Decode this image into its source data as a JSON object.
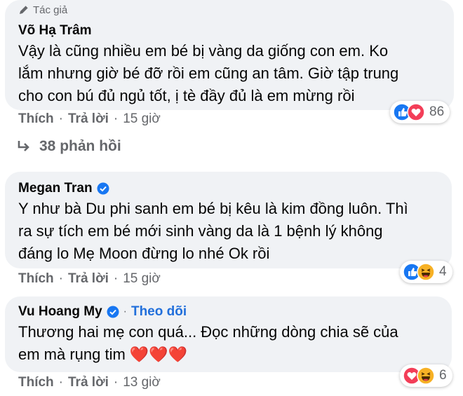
{
  "comments": [
    {
      "badge": "Tác giả",
      "author": "Võ Hạ Trâm",
      "lines": [
        "Vậy là cũng nhiều em bé bị vàng da giống con em. Ko",
        "lắm nhưng giờ bé đỡ rồi em cũng an tâm. Giờ tập trung",
        "cho con bú đủ ngủ tốt, ị tè đầy đủ là em mừng rồi"
      ],
      "like": "Thích",
      "reply": "Trả lời",
      "time": "15 giờ",
      "reactions": [
        "like",
        "love"
      ],
      "reaction_count": "86"
    },
    {
      "author": "Megan Tran",
      "verified": true,
      "lines": [
        "Y như bà Du phi sanh em bé bị kêu là kim đồng luôn. Thì",
        "ra sự tích em bé mới sinh vàng da là 1 bệnh lý không",
        "đáng lo Mẹ Moon đừng lo nhé Ok rồi"
      ],
      "like": "Thích",
      "reply": "Trả lời",
      "time": "15 giờ",
      "reactions": [
        "like",
        "haha"
      ],
      "reaction_count": "4"
    },
    {
      "author": "Vu Hoang My",
      "verified": true,
      "follow": "Theo dõi",
      "lines": [
        "Thương hai mẹ con quá... Đọc những dòng chia sẽ của",
        "em mà rụng tim ❤️❤️❤️"
      ],
      "like": "Thích",
      "reply": "Trả lời",
      "time": "13 giờ",
      "reactions": [
        "love",
        "haha"
      ],
      "reaction_count": "6"
    }
  ],
  "replies_label": "38 phản hồi",
  "colors": {
    "bubble": "#f0f2f5",
    "meta": "#65676b",
    "link": "#216fdb",
    "like": "#1877f2",
    "love": "#f33e58",
    "haha": "#f7b125"
  }
}
